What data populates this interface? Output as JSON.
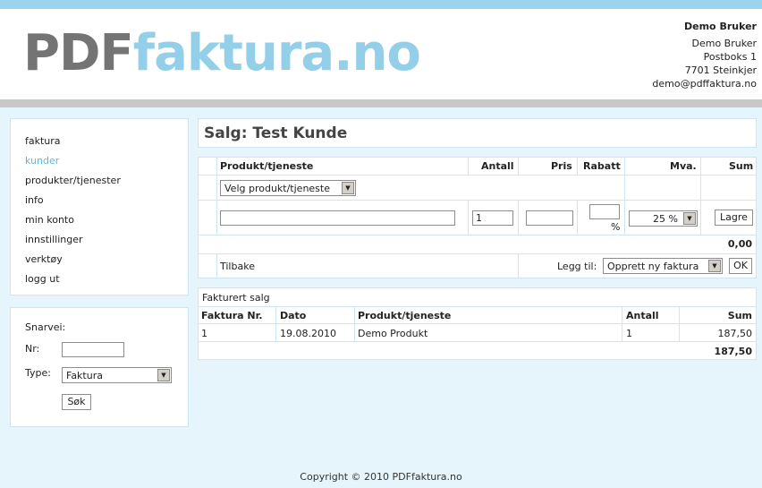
{
  "logo": {
    "part1": "PDF",
    "part2": "faktura.no"
  },
  "user": {
    "name_bold": "Demo Bruker",
    "lines": [
      "Demo Bruker",
      "Postboks 1",
      "7701 Steinkjer",
      "demo@pdffaktura.no"
    ]
  },
  "nav": {
    "items": [
      {
        "label": "faktura"
      },
      {
        "label": "kunder",
        "active": true
      },
      {
        "label": "produkter/tjenester"
      },
      {
        "label": "info"
      },
      {
        "label": "min konto"
      },
      {
        "label": "innstillinger"
      },
      {
        "label": "verktøy"
      },
      {
        "label": "logg ut"
      }
    ]
  },
  "quick": {
    "title": "Snarvei:",
    "nr_label": "Nr:",
    "nr_value": "",
    "type_label": "Type:",
    "type_value": "Faktura",
    "search_button": "Søk"
  },
  "page": {
    "title": "Salg: Test Kunde"
  },
  "grid": {
    "headers": {
      "product": "Produkt/tjeneste",
      "quantity": "Antall",
      "price": "Pris",
      "discount": "Rabatt",
      "vat": "Mva.",
      "sum": "Sum"
    },
    "product_select": "Velg produkt/tjeneste",
    "description_value": "",
    "quantity_value": "1",
    "price_value": "",
    "discount_value": "",
    "percent_sign": "%",
    "vat_value": "25 %",
    "save_button": "Lagre",
    "total": "0,00",
    "back_link": "Tilbake",
    "add_label": "Legg til:",
    "add_select": "Opprett ny faktura",
    "ok_button": "OK"
  },
  "sales": {
    "caption": "Fakturert salg",
    "headers": {
      "invoice_nr": "Faktura Nr.",
      "date": "Dato",
      "product": "Produkt/tjeneste",
      "quantity": "Antall",
      "sum": "Sum"
    },
    "rows": [
      {
        "invoice_nr": "1",
        "date": "19.08.2010",
        "product": "Demo Produkt",
        "quantity": "1",
        "sum": "187,50"
      }
    ],
    "total": "187,50"
  },
  "footer": {
    "text": "Copyright © 2010 PDFfaktura.no"
  }
}
